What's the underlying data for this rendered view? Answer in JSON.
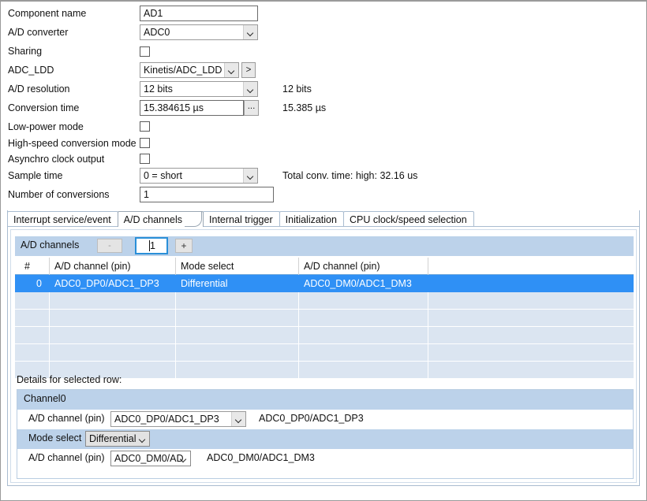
{
  "properties": [
    {
      "label": "Component name",
      "type": "text",
      "value": "AD1",
      "width": 150,
      "right": ""
    },
    {
      "label": "A/D converter",
      "type": "combo",
      "value": "ADC0",
      "width": 150,
      "right": ""
    },
    {
      "label": "Sharing",
      "type": "checkbox",
      "checked": false,
      "right": ""
    },
    {
      "label": "ADC_LDD",
      "type": "combo-button",
      "value": "Kinetis/ADC_LDD",
      "width": 126,
      "button": ">",
      "right": ""
    },
    {
      "label": "A/D resolution",
      "type": "combo",
      "value": "12 bits",
      "width": 150,
      "right": "12 bits"
    },
    {
      "label": "Conversion time",
      "type": "text-button",
      "value": "15.384615 µs",
      "width": 132,
      "button": "...",
      "right": "15.385 µs"
    },
    {
      "label": "Low-power mode",
      "type": "checkbox",
      "checked": false,
      "right": ""
    },
    {
      "label": "High-speed conversion mode",
      "type": "checkbox",
      "checked": false,
      "right": ""
    },
    {
      "label": "Asynchro clock output",
      "type": "checkbox",
      "checked": false,
      "right": ""
    },
    {
      "label": "Sample time",
      "type": "combo",
      "value": "0 = short",
      "width": 150,
      "right": "Total conv. time:  high: 32.16 us"
    },
    {
      "label": "Number of conversions",
      "type": "text",
      "value": "1",
      "width": 170,
      "right": ""
    }
  ],
  "tabs": [
    {
      "label": "Interrupt service/event",
      "active": false
    },
    {
      "label": "A/D channels",
      "active": true
    },
    {
      "label": "Internal trigger",
      "active": false
    },
    {
      "label": "Initialization",
      "active": false
    },
    {
      "label": "CPU clock/speed selection",
      "active": false
    }
  ],
  "channels_bar": {
    "title": "A/D channels",
    "minus_label": "-",
    "plus_label": "+",
    "count_value": "1"
  },
  "grid": {
    "headers": [
      "#",
      "A/D channel (pin)",
      "Mode select",
      "A/D channel (pin)",
      ""
    ],
    "rows": [
      {
        "selected": true,
        "cells": [
          "0",
          "ADC0_DP0/ADC1_DP3",
          "Differential",
          "ADC0_DM0/ADC1_DM3",
          ""
        ]
      }
    ],
    "empty_row_count": 5
  },
  "details": {
    "caption": "Details for selected row:",
    "channel_title": "Channel0",
    "rows": [
      {
        "label": "A/D channel (pin)",
        "value": "ADC0_DP0/ADC1_DP3",
        "readout": "ADC0_DP0/ADC1_DP3"
      },
      {
        "label": "Mode select",
        "value": "Differential",
        "readout": ""
      },
      {
        "label": "A/D channel (pin)",
        "value": "ADC0_DM0/AD",
        "readout": "ADC0_DM0/ADC1_DM3"
      }
    ]
  },
  "colors": {
    "band": "#bcd2ea",
    "selection": "#2f90f5",
    "grid_empty_row": "#dbe5f1",
    "focus_border": "#2a8fd8"
  }
}
